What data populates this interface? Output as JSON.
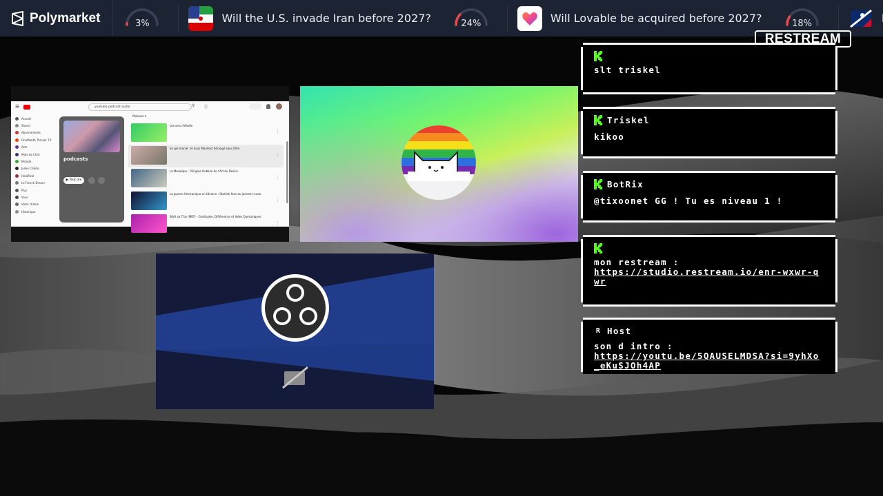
{
  "ticker": {
    "brand": "Polymarket",
    "items": [
      {
        "kind": "gauge",
        "value": "3%",
        "fraction": 0.03
      },
      {
        "kind": "market",
        "title": "Will the U.S. invade Iran before 2027?",
        "icon": "iran-flag-icon"
      },
      {
        "kind": "gauge",
        "value": "24%",
        "fraction": 0.24
      },
      {
        "kind": "market",
        "title": "Will Lovable be acquired before 2027?",
        "icon": "lovable-heart-icon"
      },
      {
        "kind": "gauge",
        "value": "18%",
        "fraction": 0.18
      },
      {
        "kind": "market",
        "title": "Pittsburgh",
        "icon": "mlb-logo-icon"
      }
    ],
    "colors": {
      "bar": "#1c2434",
      "gauge_fill": "#e64a4a",
      "gauge_track": "#3a4356"
    }
  },
  "restream_badge": "RESTREAM",
  "youtube_panel": {
    "search_text": "youtube podcast audio",
    "playlist_title": "podcasts",
    "play_label": "Tout lire",
    "sort_label": "Manuel",
    "sidebar": [
      "Accueil",
      "Shorts",
      "Abonnements",
      "OneMonth Thinker TV",
      "Arte",
      "Mots de Chat",
      "Micode",
      "Julien Chièze",
      "HolaPixel",
      "Le French Dream",
      "Plus",
      "Vous",
      "Votre chaîne",
      "Historique"
    ],
    "videos": [
      "Les sms d'élodie",
      "En gel manié : le buzz Manifest dérangé sans filtre",
      "La Mosaïque : l'Origine Oubliée de l'Art du Dessin",
      "La guerre électronique en Ukraine : Starlink face au jammer russe",
      "Bitét sa T'by (MKT) - Gratitudes, Différences et Idées Quelconques"
    ]
  },
  "chat": [
    {
      "platform": "kick",
      "user": "",
      "message": "slt triskel",
      "link": ""
    },
    {
      "platform": "kick",
      "user": "Triskel",
      "message": "kikoo",
      "link": ""
    },
    {
      "platform": "kick",
      "user": "BotRix",
      "message": "@tixoonet GG ! Tu es niveau 1 !",
      "link": ""
    },
    {
      "platform": "kick",
      "user": "",
      "message": "mon restream :",
      "link": "https://studio.restream.io/enr-wxwr-qwr"
    },
    {
      "platform": "restream",
      "user": "Host",
      "message": "son d intro :",
      "link": "https://youtu.be/5QAUSELMDSA?si=9yhXo_eKuSJOh4AP"
    }
  ],
  "colors": {
    "kick_green": "#53fc18",
    "chat_bg": "#000000",
    "obs_bg": "#141a3a"
  }
}
